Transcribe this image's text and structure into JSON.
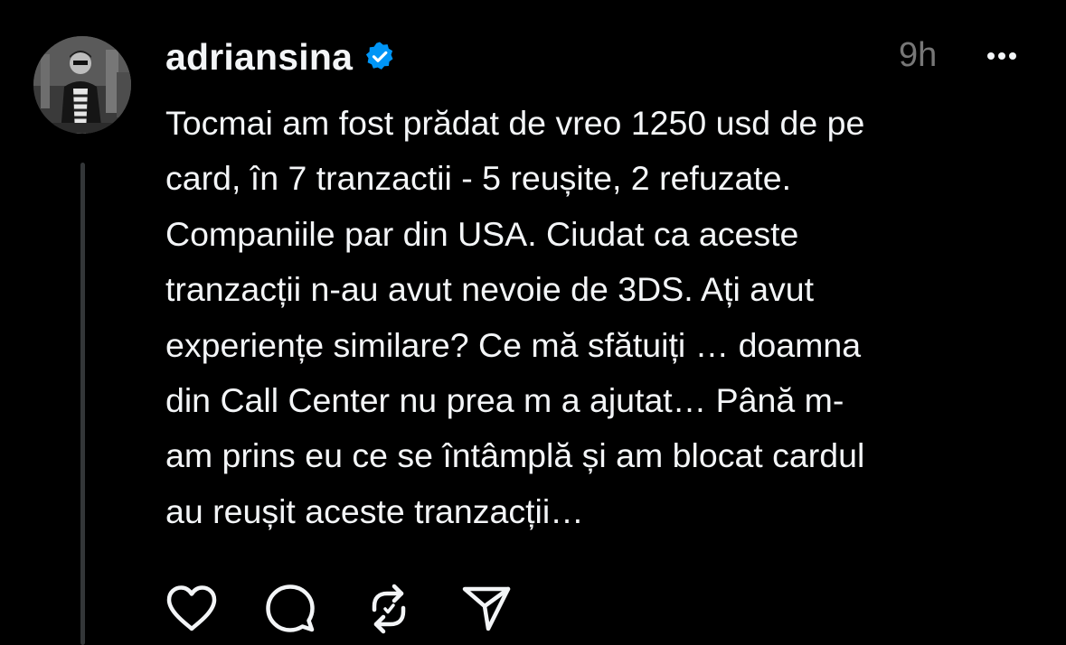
{
  "post": {
    "username": "adriansina",
    "time": "9h",
    "text": "Tocmai am fost prădat de vreo 1250 usd de pe\ncard, în 7 tranzactii - 5 reușite, 2 refuzate.\nCompaniile par din USA. Ciudat ca aceste\ntranzacții n-au avut nevoie de 3DS. Ați avut\nexperiențe similare? Ce mă sfătuiți … doamna\ndin Call Center nu prea m a ajutat… Până m-\nam prins eu ce se întâmplă și am blocat cardul\nau reușit  aceste tranzacții…"
  },
  "icons": {
    "verified": "verified-badge-icon",
    "more": "more-options-icon",
    "like": "heart-icon",
    "reply": "comment-icon",
    "repost": "repost-icon",
    "share": "send-icon"
  },
  "colors": {
    "background": "#000000",
    "text": "#f3f5f7",
    "muted": "#777777",
    "verified": "#0095f6",
    "thread_line": "#333638"
  }
}
